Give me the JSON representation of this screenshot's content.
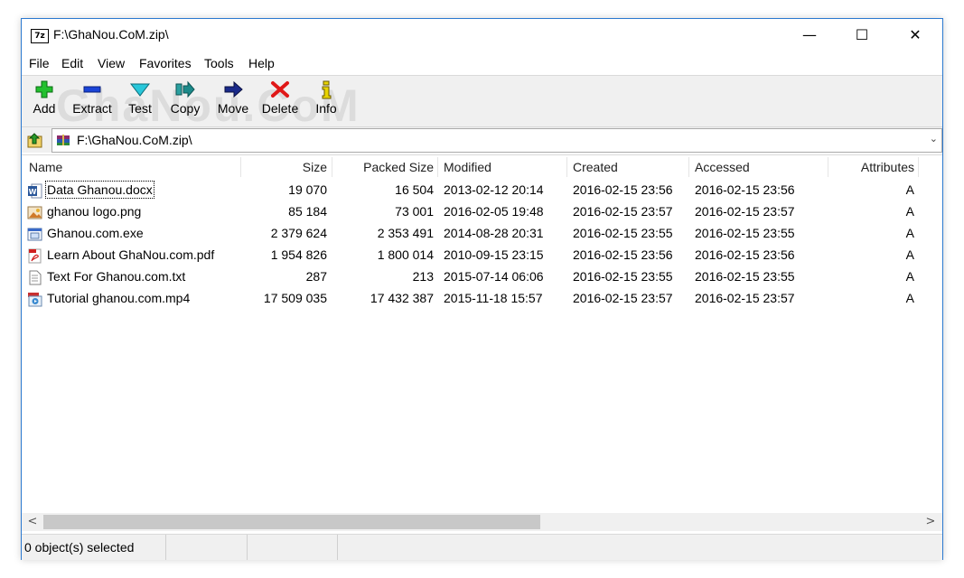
{
  "window": {
    "title": "F:\\GhaNou.CoM.zip\\",
    "app_icon_text": "7z",
    "controls": {
      "minimize": "—",
      "maximize": "☐",
      "close": "✕"
    }
  },
  "menu": [
    "File",
    "Edit",
    "View",
    "Favorites",
    "Tools",
    "Help"
  ],
  "toolbar": {
    "watermark": "GhaNou.CoM",
    "buttons": [
      {
        "label": "Add",
        "icon": "add-icon",
        "color": "#1aae2a"
      },
      {
        "label": "Extract",
        "icon": "extract-icon",
        "color": "#1040c8"
      },
      {
        "label": "Test",
        "icon": "test-icon",
        "color": "#1ab5c8"
      },
      {
        "label": "Copy",
        "icon": "copy-icon",
        "color": "#1c8a8a"
      },
      {
        "label": "Move",
        "icon": "move-icon",
        "color": "#1a2a88"
      },
      {
        "label": "Delete",
        "icon": "delete-icon",
        "color": "#e01818"
      },
      {
        "label": "Info",
        "icon": "info-icon",
        "color": "#e8d400"
      }
    ]
  },
  "address": {
    "path": "F:\\GhaNou.CoM.zip\\"
  },
  "columns": [
    "Name",
    "Size",
    "Packed Size",
    "Modified",
    "Created",
    "Accessed",
    "Attributes"
  ],
  "files": [
    {
      "name": "Data Ghanou.docx",
      "size": "19 070",
      "packed": "16 504",
      "modified": "2013-02-12 20:14",
      "created": "2016-02-15 23:56",
      "accessed": "2016-02-15 23:56",
      "attr": "A",
      "icon": "word-doc-icon"
    },
    {
      "name": "ghanou logo.png",
      "size": "85 184",
      "packed": "73 001",
      "modified": "2016-02-05 19:48",
      "created": "2016-02-15 23:57",
      "accessed": "2016-02-15 23:57",
      "attr": "A",
      "icon": "image-file-icon"
    },
    {
      "name": "Ghanou.com.exe",
      "size": "2 379 624",
      "packed": "2 353 491",
      "modified": "2014-08-28 20:31",
      "created": "2016-02-15 23:55",
      "accessed": "2016-02-15 23:55",
      "attr": "A",
      "icon": "exe-file-icon"
    },
    {
      "name": "Learn About GhaNou.com.pdf",
      "size": "1 954 826",
      "packed": "1 800 014",
      "modified": "2010-09-15 23:15",
      "created": "2016-02-15 23:56",
      "accessed": "2016-02-15 23:56",
      "attr": "A",
      "icon": "pdf-file-icon"
    },
    {
      "name": "Text For Ghanou.com.txt",
      "size": "287",
      "packed": "213",
      "modified": "2015-07-14 06:06",
      "created": "2016-02-15 23:55",
      "accessed": "2016-02-15 23:55",
      "attr": "A",
      "icon": "text-file-icon"
    },
    {
      "name": "Tutorial ghanou.com.mp4",
      "size": "17 509 035",
      "packed": "17 432 387",
      "modified": "2015-11-18 15:57",
      "created": "2016-02-15 23:57",
      "accessed": "2016-02-15 23:57",
      "attr": "A",
      "icon": "video-file-icon"
    }
  ],
  "scroll": {
    "left_arrow": "<",
    "right_arrow": ">"
  },
  "status": {
    "selected": "0 object(s) selected"
  }
}
